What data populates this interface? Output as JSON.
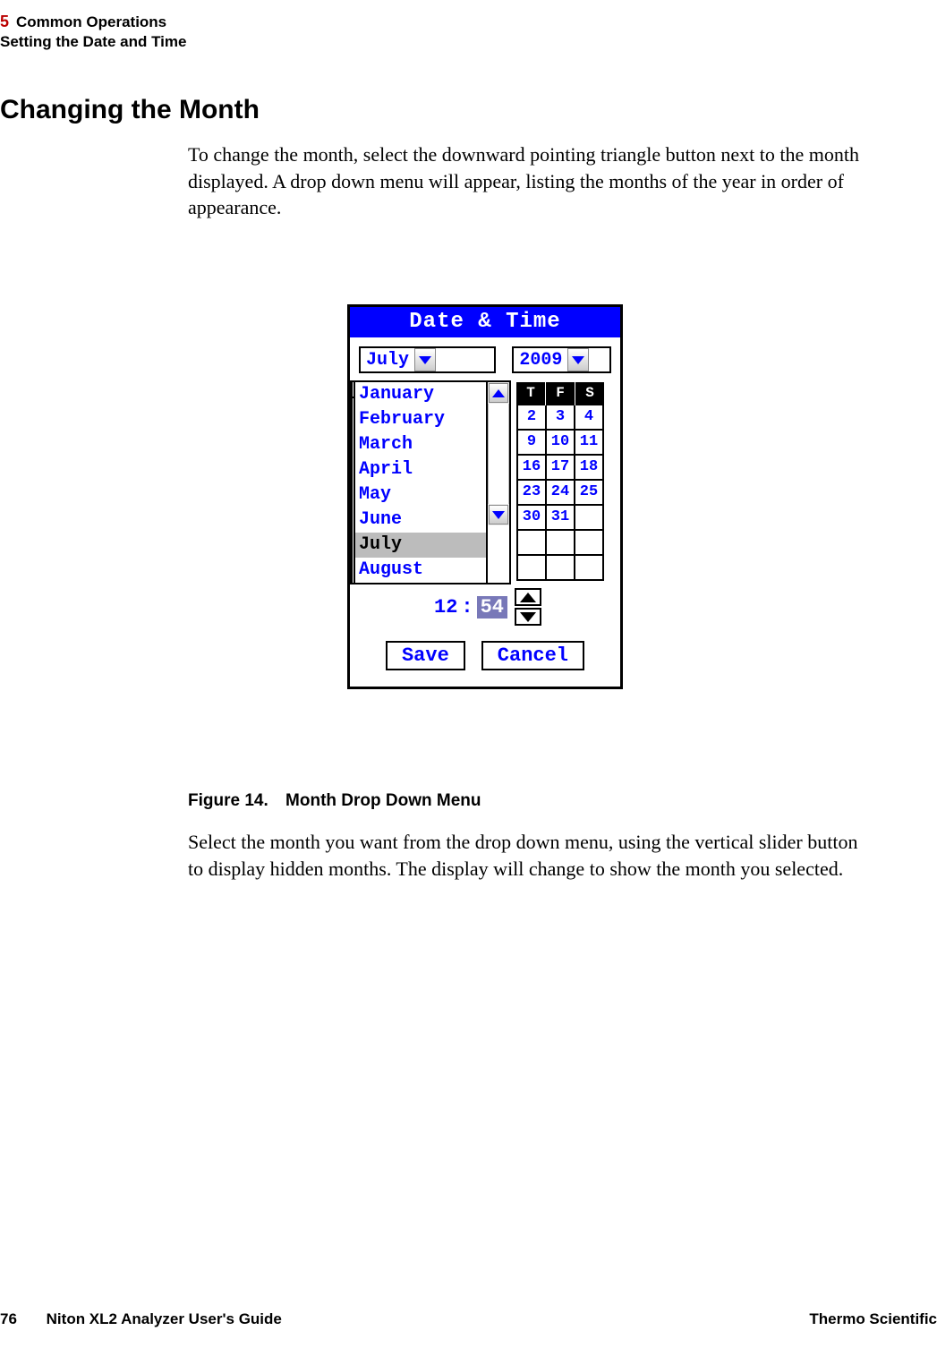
{
  "header": {
    "chapter_num": "5",
    "chapter_title": "Common Operations",
    "section": "Setting the Date and Time"
  },
  "heading": "Changing the Month",
  "para1": "To change the month, select the downward pointing triangle button next to the month displayed. A drop down menu will appear, listing the months of the year in order of appearance.",
  "screen": {
    "title": "Date & Time",
    "month": "July",
    "year": "2009",
    "week_header": [
      "T",
      "F",
      "S"
    ],
    "cal_rows": [
      [
        "2",
        "3",
        "4"
      ],
      [
        "9",
        "10",
        "11"
      ],
      [
        "16",
        "17",
        "18"
      ],
      [
        "23",
        "24",
        "25"
      ],
      [
        "30",
        "31",
        ""
      ]
    ],
    "extra_rows": 2,
    "months_list": [
      "January",
      "February",
      "March",
      "April",
      "May",
      "June",
      "July",
      "August"
    ],
    "selected_month": "July",
    "time_hh": "12",
    "time_mm": "54",
    "save": "Save",
    "cancel": "Cancel"
  },
  "figure": {
    "num": "Figure 14.",
    "title": "Month Drop Down Menu"
  },
  "para2": "Select the month you want from the drop down menu, using the vertical slider button to display hidden months. The display will change to show the month you selected.",
  "footer": {
    "page": "76",
    "guide": "Niton XL2 Analyzer User's Guide",
    "brand": "Thermo Scientific"
  }
}
